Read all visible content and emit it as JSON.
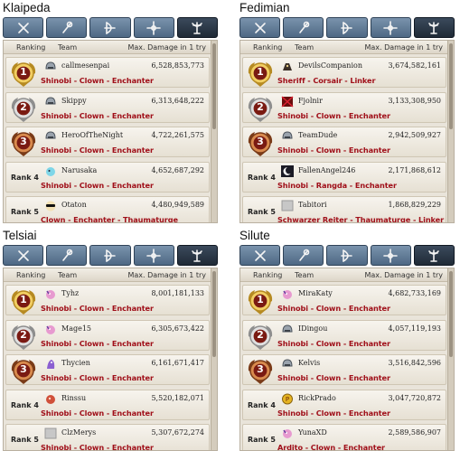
{
  "header_labels": {
    "ranking": "Ranking",
    "team": "Team",
    "max_damage": "Max. Damage in 1 try"
  },
  "tab_icons": [
    "swords-icon",
    "staff-icon",
    "bow-icon",
    "cross-icon",
    "cleric-icon"
  ],
  "colors": {
    "class_text": "#a0101a",
    "tab_blue": "#5f7893",
    "tab_active": "#2a3645",
    "gold": "#c9a23a",
    "silver": "#b5b5b5",
    "bronze": "#a0522d"
  },
  "servers": [
    {
      "name": "Klaipeda",
      "rows": [
        {
          "rank": "1",
          "player": "callmesenpai",
          "damage": "6,528,853,773",
          "classes": "Shinobi - Clown - Enchanter",
          "avatar": "helmet"
        },
        {
          "rank": "2",
          "player": "Skippy",
          "damage": "6,313,648,222",
          "classes": "Shinobi - Clown - Enchanter",
          "avatar": "helmet"
        },
        {
          "rank": "3",
          "player": "HeroOfTheNight",
          "damage": "4,722,261,575",
          "classes": "Shinobi - Clown - Enchanter",
          "avatar": "helmet"
        },
        {
          "rank": "Rank 4",
          "player": "Narusaka",
          "damage": "4,652,687,292",
          "classes": "Shinobi - Clown - Enchanter",
          "avatar": "cyan-creature"
        },
        {
          "rank": "Rank 5",
          "player": "Otaton",
          "damage": "4,480,949,589",
          "classes": "Clown - Enchanter - Thaumaturge",
          "avatar": "sunglasses"
        }
      ]
    },
    {
      "name": "Fedimian",
      "rows": [
        {
          "rank": "1",
          "player": "DevilsCompanion",
          "damage": "3,674,582,161",
          "classes": "Sheriff - Corsair - Linker",
          "avatar": "dark-creature"
        },
        {
          "rank": "2",
          "player": "Fjolnir",
          "damage": "3,133,308,950",
          "classes": "Shinobi - Clown - Enchanter",
          "avatar": "red-pattern"
        },
        {
          "rank": "3",
          "player": "TeamDude",
          "damage": "2,942,509,927",
          "classes": "Shinobi - Clown - Enchanter",
          "avatar": "helmet"
        },
        {
          "rank": "Rank 4",
          "player": "FallenAngel246",
          "damage": "2,171,868,612",
          "classes": "Shinobi - Rangda - Enchanter",
          "avatar": "moon"
        },
        {
          "rank": "Rank 5",
          "player": "Tabitori",
          "damage": "1,868,829,229",
          "classes": "Schwarzer Reiter - Thaumaturge - Linker",
          "avatar": "blank"
        }
      ]
    },
    {
      "name": "Telsiai",
      "rows": [
        {
          "rank": "1",
          "player": "Tyhz",
          "damage": "8,001,181,133",
          "classes": "Shinobi - Clown - Enchanter",
          "avatar": "pink-creature"
        },
        {
          "rank": "2",
          "player": "Mage15",
          "damage": "6,305,673,422",
          "classes": "Shinobi - Clown - Enchanter",
          "avatar": "pink-creature"
        },
        {
          "rank": "3",
          "player": "Thycien",
          "damage": "6,161,671,417",
          "classes": "Shinobi - Clown - Enchanter",
          "avatar": "purple-creature"
        },
        {
          "rank": "Rank 4",
          "player": "Rinssu",
          "damage": "5,520,182,071",
          "classes": "Shinobi - Clown - Enchanter",
          "avatar": "red-creature"
        },
        {
          "rank": "Rank 5",
          "player": "ClzMerys",
          "damage": "5,307,672,274",
          "classes": "Shinobi - Clown - Enchanter",
          "avatar": "blank"
        }
      ]
    },
    {
      "name": "Silute",
      "rows": [
        {
          "rank": "1",
          "player": "MiraKaty",
          "damage": "4,682,733,169",
          "classes": "Shinobi - Clown - Enchanter",
          "avatar": "pink-creature"
        },
        {
          "rank": "2",
          "player": "IDingou",
          "damage": "4,057,119,193",
          "classes": "Shinobi - Clown - Enchanter",
          "avatar": "helmet"
        },
        {
          "rank": "3",
          "player": "Kelvis",
          "damage": "3,516,842,596",
          "classes": "Shinobi - Clown - Enchanter",
          "avatar": "helmet"
        },
        {
          "rank": "Rank 4",
          "player": "RickPrado",
          "damage": "3,047,720,872",
          "classes": "Shinobi - Clown - Enchanter",
          "avatar": "yellow-badge"
        },
        {
          "rank": "Rank 5",
          "player": "YunaXD",
          "damage": "2,589,586,907",
          "classes": "Ardito - Clown - Enchanter",
          "avatar": "pink-creature"
        }
      ]
    }
  ]
}
